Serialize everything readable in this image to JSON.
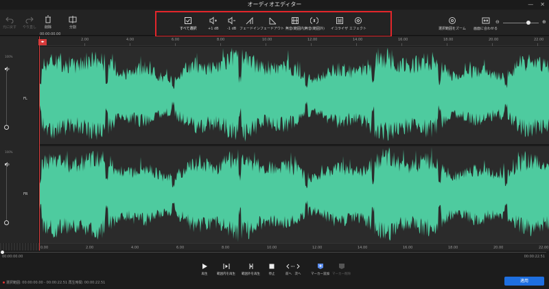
{
  "window": {
    "title": "オーディオエディター"
  },
  "toolbar": {
    "undo": "元に戻す",
    "redo": "やり直し",
    "delete": "削除",
    "split": "分割",
    "select_all": "すべて選択",
    "volume_up": "+1 dB",
    "volume_down": "-1 dB",
    "fade_in": "フェードイン",
    "fade_out": "フェードアウト",
    "mute_selection": "無音(範囲内)",
    "mute_outside": "無音(範囲外)",
    "equalizer": "イコライザ",
    "effects": "エフェクト",
    "zoom_selection": "選択範囲をズーム",
    "fit_to_screen": "画面に合わせる"
  },
  "timeline": {
    "timecode": "00:00:00.00",
    "ticks": [
      "2.00",
      "4.00",
      "6.00",
      "8.00",
      "10.00",
      "12.00",
      "14.00",
      "16.00",
      "18.00",
      "20.00",
      "22.00"
    ],
    "bottom_ticks": [
      "0.00",
      "2.00",
      "4.00",
      "6.00",
      "8.00",
      "10.00",
      "12.00",
      "14.00",
      "16.00",
      "18.00",
      "20.00",
      "22.00"
    ]
  },
  "tracks": [
    {
      "channel": "FL",
      "volume": "100%"
    },
    {
      "channel": "FR",
      "volume": "100%"
    }
  ],
  "playback": {
    "current_time": "00:00:00.00",
    "total_time": "00:00:22.51",
    "play": "再生",
    "play_in_range": "範囲内を再生",
    "play_outside_range": "範囲外を再生",
    "stop": "停止",
    "prev_next": "前へ　次へ",
    "add_marker": "マーカー追加",
    "delete_marker": "マーカー削除"
  },
  "status": {
    "text": "選択範囲: 00:00:00.00 - 00:00:22.51  再生時間: 00:00:22.51"
  },
  "apply_button": "適用",
  "colors": {
    "waveform": "#4ecb9f",
    "accent": "#1e6fe0",
    "highlight": "#e5262b"
  }
}
